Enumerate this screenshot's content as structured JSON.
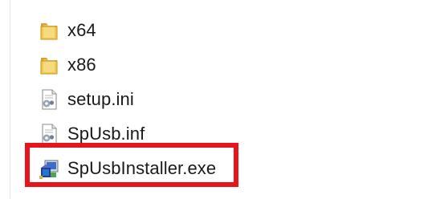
{
  "files": [
    {
      "name": "x64",
      "icon": "folder-icon",
      "type": "folder"
    },
    {
      "name": "x86",
      "icon": "folder-icon",
      "type": "folder"
    },
    {
      "name": "setup.ini",
      "icon": "config-file-icon",
      "type": "ini"
    },
    {
      "name": "SpUsb.inf",
      "icon": "config-file-icon",
      "type": "inf"
    },
    {
      "name": "SpUsbInstaller.exe",
      "icon": "installer-icon",
      "type": "exe"
    }
  ],
  "highlight": {
    "target": "SpUsbInstaller.exe",
    "color": "#e8141b"
  },
  "colors": {
    "folder": "#e8b93c",
    "text": "#1a1a1a"
  }
}
